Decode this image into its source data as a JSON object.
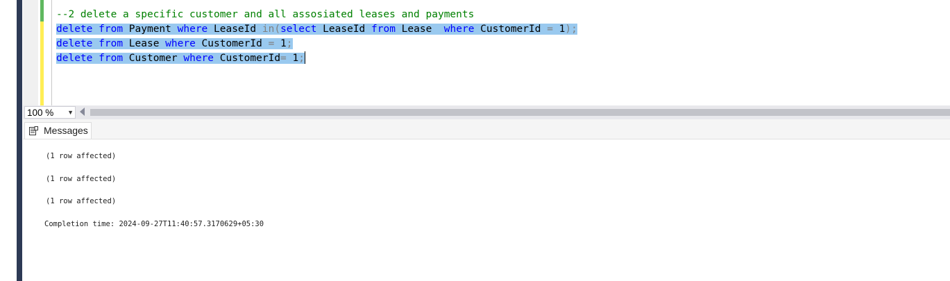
{
  "editor": {
    "lines": [
      {
        "selected": false,
        "tokens": [
          {
            "t": "--2 delete a specific customer and all assosiated leases and payments",
            "c": "cm"
          }
        ]
      },
      {
        "selected": true,
        "tokens": [
          {
            "t": "delete",
            "c": "kw"
          },
          {
            "t": " ",
            "c": ""
          },
          {
            "t": "from",
            "c": "kw"
          },
          {
            "t": " Payment ",
            "c": ""
          },
          {
            "t": "where",
            "c": "kw"
          },
          {
            "t": " LeaseId ",
            "c": ""
          },
          {
            "t": "in(",
            "c": "gr"
          },
          {
            "t": "select",
            "c": "kw"
          },
          {
            "t": " LeaseId ",
            "c": ""
          },
          {
            "t": "from",
            "c": "kw"
          },
          {
            "t": " Lease  ",
            "c": ""
          },
          {
            "t": "where",
            "c": "kw"
          },
          {
            "t": " CustomerId ",
            "c": ""
          },
          {
            "t": "=",
            "c": "gr"
          },
          {
            "t": " 1",
            "c": ""
          },
          {
            "t": ");",
            "c": "gr"
          }
        ]
      },
      {
        "selected": true,
        "tokens": [
          {
            "t": "delete",
            "c": "kw"
          },
          {
            "t": " ",
            "c": ""
          },
          {
            "t": "from",
            "c": "kw"
          },
          {
            "t": " Lease ",
            "c": ""
          },
          {
            "t": "where",
            "c": "kw"
          },
          {
            "t": " CustomerId ",
            "c": ""
          },
          {
            "t": "=",
            "c": "gr"
          },
          {
            "t": " 1",
            "c": ""
          },
          {
            "t": ";",
            "c": "gr"
          }
        ]
      },
      {
        "selected": true,
        "caret": true,
        "tokens": [
          {
            "t": "delete",
            "c": "kw"
          },
          {
            "t": " ",
            "c": ""
          },
          {
            "t": "from",
            "c": "kw"
          },
          {
            "t": " Customer ",
            "c": ""
          },
          {
            "t": "where",
            "c": "kw"
          },
          {
            "t": " CustomerId",
            "c": ""
          },
          {
            "t": "=",
            "c": "gr"
          },
          {
            "t": " 1",
            "c": ""
          },
          {
            "t": ";",
            "c": "gr"
          }
        ]
      }
    ]
  },
  "zoom": {
    "value": "100 %",
    "arrow_icon": "dropdown-arrow-icon"
  },
  "results": {
    "tab_label": "Messages",
    "tab_icon": "messages-icon",
    "messages": [
      "(1 row affected)",
      "(1 row affected)",
      "(1 row affected)",
      "Completion time: 2024-09-27T11:40:57.3170629+05:30"
    ]
  },
  "colors": {
    "keyword": "#0000ff",
    "comment": "#008000",
    "operator": "#808080",
    "selection": "#99c9ef"
  }
}
